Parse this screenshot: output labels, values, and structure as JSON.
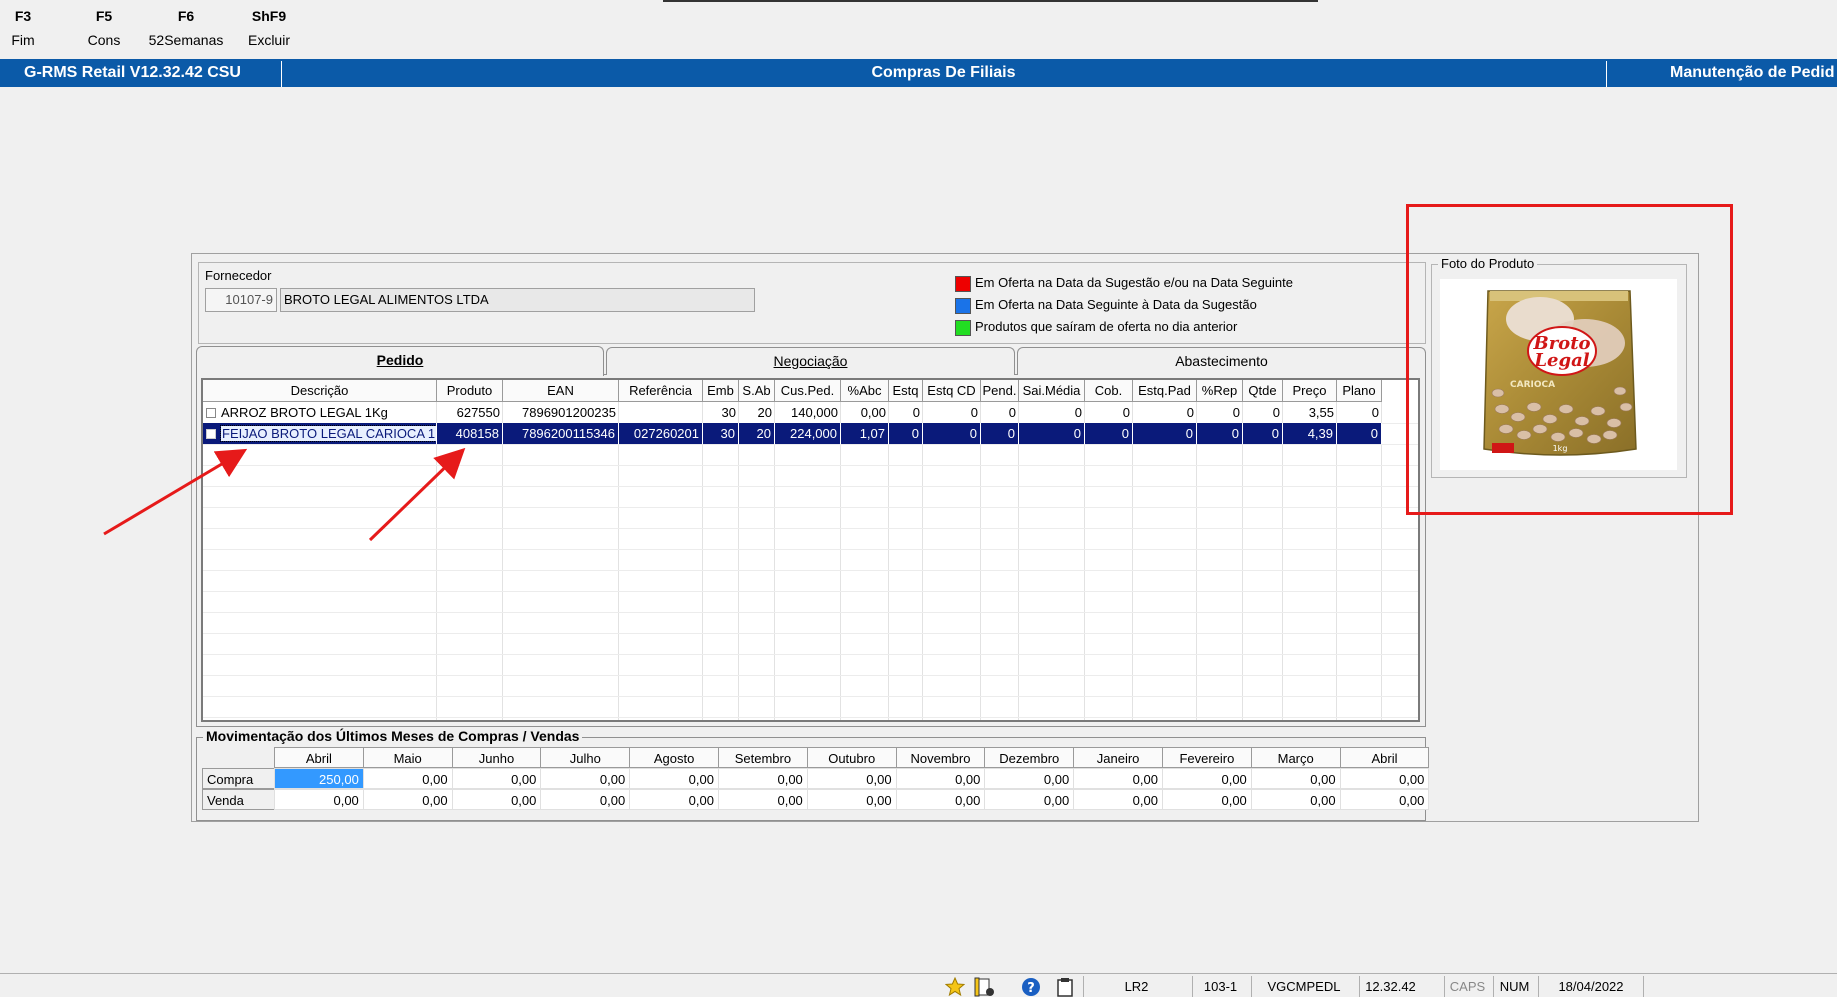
{
  "function_keys": [
    {
      "key": "F3",
      "label": "Fim"
    },
    {
      "key": "F5",
      "label": "Cons"
    },
    {
      "key": "F6",
      "label": "52Semanas"
    },
    {
      "key": "ShF9",
      "label": "Excluir"
    }
  ],
  "titlebar": {
    "app": "G-RMS Retail V12.32.42 CSU",
    "screen": "Compras De Filiais",
    "right": "Manutenção de Pedid"
  },
  "fornecedor": {
    "label": "Fornecedor",
    "code": "10107-9",
    "name": "BROTO LEGAL ALIMENTOS LTDA"
  },
  "legend": [
    {
      "color": "#ee0000",
      "text": "Em Oferta na Data da Sugestão e/ou na Data Seguinte"
    },
    {
      "color": "#1a73e8",
      "text": "Em Oferta na Data Seguinte à Data da Sugestão"
    },
    {
      "color": "#22dd22",
      "text": "Produtos que saíram de oferta no dia anterior"
    }
  ],
  "tabs": [
    {
      "label": "Pedido",
      "active": true
    },
    {
      "label": "Negociação",
      "active": false
    },
    {
      "label": "Abastecimento",
      "active": false
    }
  ],
  "grid": {
    "columns": [
      "Descrição",
      "Produto",
      "EAN",
      "Referência",
      "Emb",
      "S.Ab",
      "Cus.Ped.",
      "%Abc",
      "Estq",
      "Estq CD",
      "Pend.",
      "Sai.Média",
      "Cob.",
      "Estq.Pad",
      "%Rep",
      "Qtde",
      "Preço",
      "Plano"
    ],
    "rows": [
      {
        "cells": [
          "ARROZ BROTO LEGAL 1Kg",
          "627550",
          "7896901200235",
          "",
          "30",
          "20",
          "140,000",
          "0,00",
          "0",
          "0",
          "0",
          "0",
          "0",
          "0",
          "0",
          "0",
          "3,55",
          "0"
        ],
        "selected": false
      },
      {
        "cells": [
          "FEIJAO BROTO LEGAL CARIOCA 1",
          "408158",
          "7896200115346",
          "027260201",
          "30",
          "20",
          "224,000",
          "1,07",
          "0",
          "0",
          "0",
          "0",
          "0",
          "0",
          "0",
          "0",
          "4,39",
          "0"
        ],
        "selected": true
      }
    ]
  },
  "movement": {
    "title": "Movimentação dos Últimos Meses de Compras / Vendas",
    "months": [
      "Abril",
      "Maio",
      "Junho",
      "Julho",
      "Agosto",
      "Setembro",
      "Outubro",
      "Novembro",
      "Dezembro",
      "Janeiro",
      "Fevereiro",
      "Março",
      "Abril"
    ],
    "rows": [
      {
        "label": "Compra",
        "values": [
          "250,00",
          "0,00",
          "0,00",
          "0,00",
          "0,00",
          "0,00",
          "0,00",
          "0,00",
          "0,00",
          "0,00",
          "0,00",
          "0,00",
          "0,00"
        ]
      },
      {
        "label": "Venda",
        "values": [
          "0,00",
          "0,00",
          "0,00",
          "0,00",
          "0,00",
          "0,00",
          "0,00",
          "0,00",
          "0,00",
          "0,00",
          "0,00",
          "0,00",
          "0,00"
        ]
      }
    ]
  },
  "photo": {
    "title": "Foto do Produto",
    "brand_line1": "Broto",
    "brand_line2": "Legal",
    "variety": "CARIOCA",
    "weight": "1kg"
  },
  "statusbar": {
    "fields": [
      "LR2",
      "103-1",
      "VGCMPEDL",
      "12.32.42",
      "CAPS",
      "NUM",
      "18/04/2022"
    ]
  }
}
